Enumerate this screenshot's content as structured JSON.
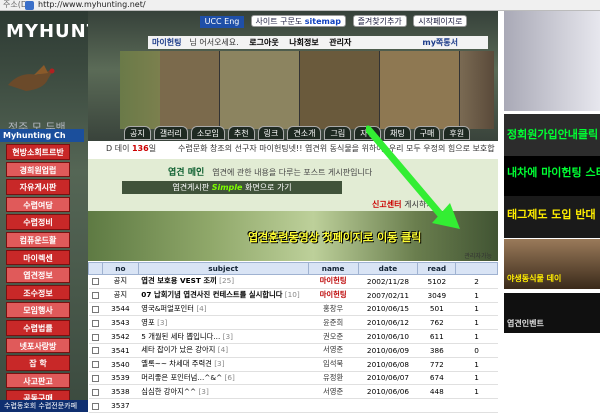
{
  "browser": {
    "address_label": "주소(D)",
    "url": "http://www.myhunting.net/"
  },
  "site": {
    "logo": "MYHUNTING",
    "channel": "Myhunting Ch",
    "left_bottom_text": "정주    모 두밴",
    "left_footer": "수렵동호회 수렵전문카페"
  },
  "top_nav": {
    "ucc": "UCC Eng",
    "startpage_pre": "사이트 구문도",
    "sitemap": "sitemap",
    "favorites": "즐겨찾기추가",
    "start": "시작페이지로"
  },
  "welcome": {
    "name": "마이헌팅",
    "text": "님 어서오세요.",
    "logout": "로그아웃",
    "myinfo": "나회정보",
    "admin": "관리자",
    "my": "my쪽통서"
  },
  "tabs": [
    "공지",
    "갤러리",
    "소모임",
    "추천",
    "링크",
    "견소개",
    "그림",
    "자유",
    "채팅",
    "구매",
    "후원"
  ],
  "left_menu": [
    "현방소회트르반",
    "경희원업럽",
    "자유게시판",
    "수렵여담",
    "수렵정비",
    "컴퓨운드활",
    "마이렉센",
    "엽견정보",
    "조수정보",
    "모임행사",
    "수렵법률",
    "넷포사랑방",
    "잡 학",
    "사고판고",
    "공동구매"
  ],
  "dday": {
    "prefix": "D 데이",
    "num": "136",
    "suffix": "일",
    "message": "수렵문화 창조의 선구자 마이헌팅넷!! 엽견위 동식물을 위하여, 우리 모두 우정의 힘으로 보호합시다"
  },
  "board_header": {
    "title": "엽견 메인",
    "desc": "엽견에 관한 내용을 다루는 포스트 게시판입니다"
  },
  "board_strip": {
    "pre": "엽견게시판",
    "strong": "Simple",
    "post": "화면으로 가기"
  },
  "report": {
    "label": "신고센터",
    "link": "게시하기"
  },
  "banner": {
    "text": "엽견훈련동영상 첫페이지로 이동 클릭",
    "small": "관리자가능"
  },
  "columns": [
    "no",
    "subject",
    "name",
    "date",
    "read",
    ""
  ],
  "rows": [
    {
      "no": "공지",
      "subject": "엽견 보호용 VEST 조끼",
      "count": "[25]",
      "name": "마이헌팅",
      "date": "2002/11/28",
      "read": "5102",
      "rec": "2",
      "admin": true
    },
    {
      "no": "공지",
      "subject": "07 납회기념 엽견사진 컨테스트를 실시합니다",
      "count": "[10]",
      "name": "마이헌팅",
      "date": "2007/02/11",
      "read": "3049",
      "rec": "1",
      "admin": true
    },
    {
      "no": "3544",
      "subject": "영국&퍼얼포인터",
      "count": "[4]",
      "name": "홍창우",
      "date": "2010/06/15",
      "read": "501",
      "rec": "1",
      "admin": false
    },
    {
      "no": "3543",
      "subject": "영포",
      "count": "[3]",
      "name": "윤준희",
      "date": "2010/06/12",
      "read": "762",
      "rec": "1",
      "admin": false
    },
    {
      "no": "3542",
      "subject": "5 개월된 세타 뽑입니다...",
      "count": "[3]",
      "name": "권오준",
      "date": "2010/06/10",
      "read": "611",
      "rec": "1",
      "admin": false
    },
    {
      "no": "3541",
      "subject": "세타 잡이가 났은 강아지",
      "count": "[4]",
      "name": "서영준",
      "date": "2010/06/09",
      "read": "386",
      "rec": "0",
      "admin": false
    },
    {
      "no": "3540",
      "subject": "옐록~~ 차세대 주력견",
      "count": "[3]",
      "name": "임석묵",
      "date": "2010/06/08",
      "read": "772",
      "rec": "1",
      "admin": false
    },
    {
      "no": "3539",
      "subject": "머리좋은 포인터넘...^&^",
      "count": "[6]",
      "name": "유정환",
      "date": "2010/06/07",
      "read": "674",
      "rec": "1",
      "admin": false
    },
    {
      "no": "3538",
      "subject": "심심한 강아지^^",
      "count": "[3]",
      "name": "서영준",
      "date": "2010/06/06",
      "read": "448",
      "rec": "1",
      "admin": false
    },
    {
      "no": "3537",
      "subject": "",
      "count": "",
      "name": "",
      "date": "",
      "read": "",
      "rec": "",
      "admin": false
    }
  ],
  "right_ads": [
    "정회원가입안내클릭",
    "내차에 마이헌팅 스티",
    "태그제도 도입 반대",
    "야생동식물 데이",
    "엽견인벤트"
  ],
  "colors": {
    "menu_red": "#c82828",
    "ad_green": "#00ff33",
    "ad_yellow": "#ffee00",
    "header_blue": "#d9e4f5",
    "green_arrow": "#33ee33"
  }
}
